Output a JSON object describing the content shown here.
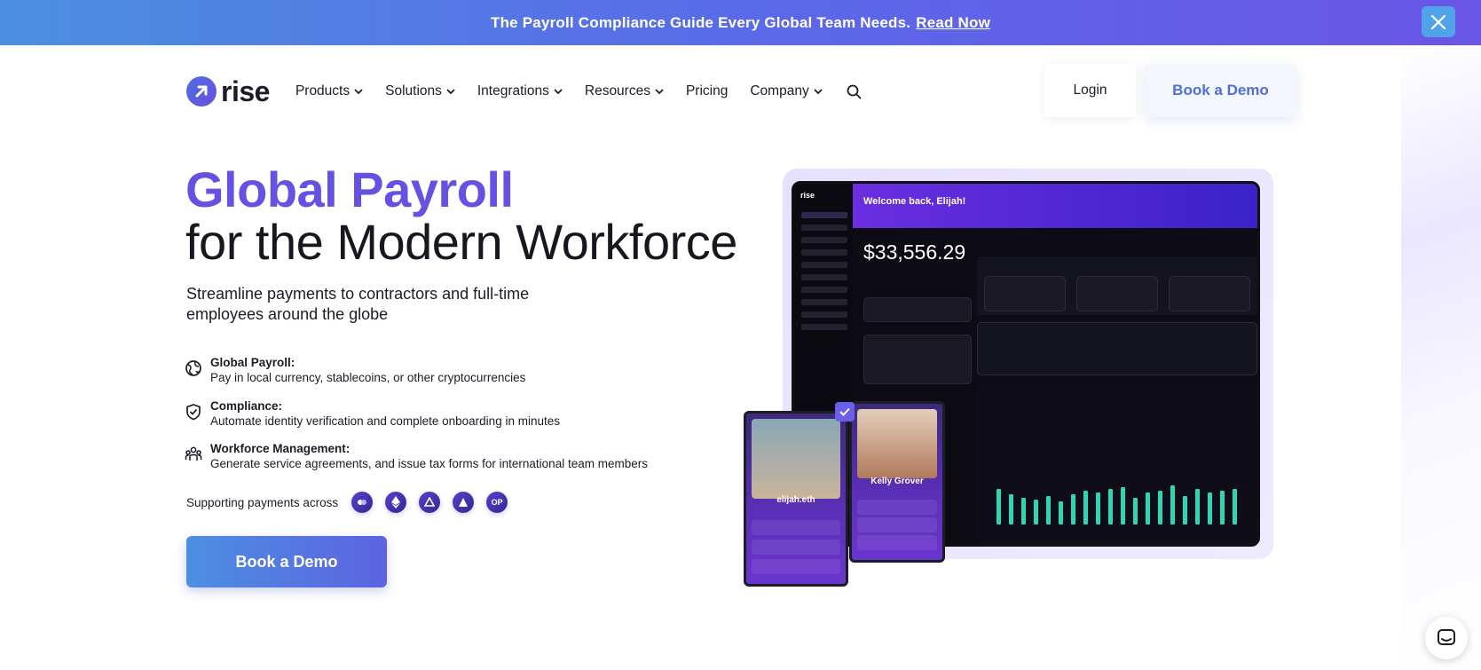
{
  "banner": {
    "text": "The Payroll Compliance Guide Every Global Team Needs.",
    "link": "Read Now"
  },
  "nav": {
    "logo": "rise",
    "items": [
      "Products",
      "Solutions",
      "Integrations",
      "Resources",
      "Pricing",
      "Company"
    ],
    "login": "Login",
    "demo": "Book a Demo"
  },
  "hero": {
    "title_accent": "Global Payroll",
    "title_rest": "for the Modern Workforce",
    "subtitle": "Streamline payments to contractors and full-time employees around the globe"
  },
  "features": [
    {
      "title": "Global Payroll:",
      "desc": "Pay in local currency, stablecoins, or other cryptocurrencies",
      "icon": "globe-icon"
    },
    {
      "title": "Compliance:",
      "desc": "Automate identity verification and complete onboarding in minutes",
      "icon": "shield-check-icon"
    },
    {
      "title": "Workforce Management:",
      "desc": "Generate service agreements, and issue tax forms for international team members",
      "icon": "team-icon"
    }
  ],
  "support": {
    "label": "Supporting payments across",
    "chains": [
      "",
      "",
      "",
      "",
      "OP"
    ]
  },
  "cta": "Book a Demo",
  "dashboard": {
    "welcome": "Welcome back, Elijah!",
    "amount": "$33,556.29"
  },
  "profiles": [
    {
      "name": "elijah.eth"
    },
    {
      "name": "Kelly Grover"
    }
  ],
  "colors": {
    "accent": "#6552e3",
    "cta_start": "#4c8fe2",
    "cta_end": "#5d63e0"
  }
}
